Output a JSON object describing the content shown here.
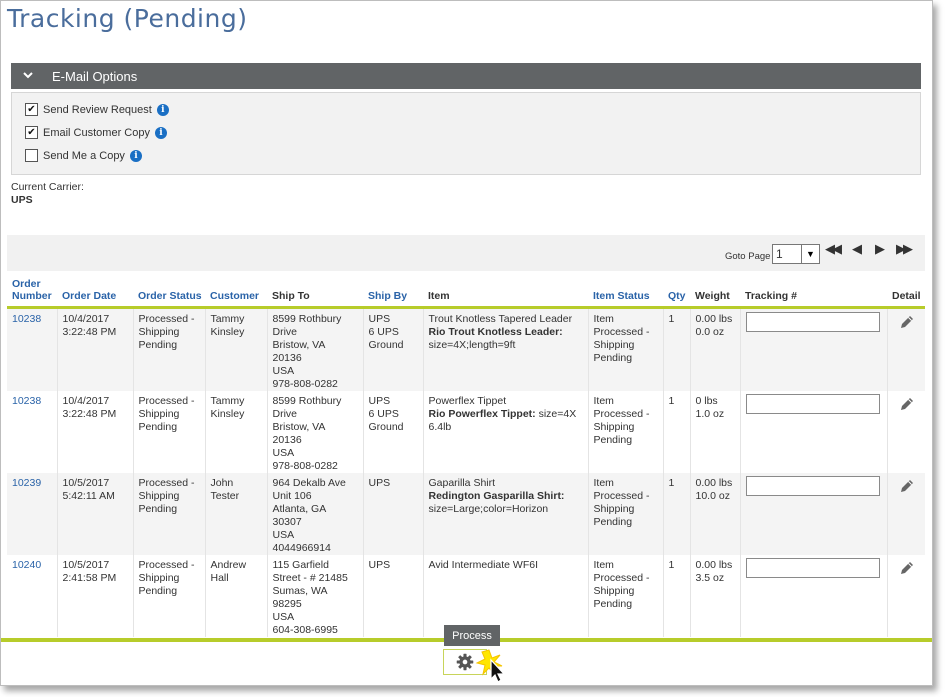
{
  "page": {
    "title": "Tracking (Pending)"
  },
  "email_options": {
    "title": "E-Mail Options",
    "options": [
      {
        "label": "Send Review Request",
        "checked": true
      },
      {
        "label": "Email Customer Copy",
        "checked": true
      },
      {
        "label": "Send Me a Copy",
        "checked": false
      }
    ]
  },
  "carrier": {
    "label": "Current Carrier:",
    "value": "UPS"
  },
  "pager": {
    "goto_label": "Goto Page",
    "page": "1"
  },
  "table": {
    "headers": {
      "order_number_1": "Order",
      "order_number_2": "Number",
      "order_date": "Order Date",
      "order_status": "Order Status",
      "customer": "Customer",
      "ship_to": "Ship To",
      "ship_by": "Ship By",
      "item": "Item",
      "item_status": "Item Status",
      "qty": "Qty",
      "weight": "Weight",
      "tracking": "Tracking #",
      "detail": "Detail"
    },
    "rows": [
      {
        "order_number": "10238",
        "date": "10/4/2017",
        "time": "3:22:48 PM",
        "status_1": "Processed -",
        "status_2": "Shipping",
        "status_3": "Pending",
        "customer_1": "Tammy",
        "customer_2": "Kinsley",
        "ship_1": "8599 Rothbury",
        "ship_2": "Drive",
        "ship_3": "Bristow, VA",
        "ship_4": "20136",
        "ship_5": "USA",
        "ship_6": "978-808-0282",
        "shipby_1": "UPS",
        "shipby_2": "6 UPS",
        "shipby_3": "Ground",
        "item_name": "Trout Knotless Tapered Leader",
        "item_detail_bold": "Rio Trout Knotless Leader:",
        "item_detail": "size=4X;length=9ft",
        "item_status_1": "Item",
        "item_status_2": "Processed -",
        "item_status_3": "Shipping",
        "item_status_4": "Pending",
        "qty": "1",
        "weight_1": "0.00 lbs",
        "weight_2": "0.0 oz"
      },
      {
        "order_number": "10238",
        "date": "10/4/2017",
        "time": "3:22:48 PM",
        "status_1": "Processed -",
        "status_2": "Shipping",
        "status_3": "Pending",
        "customer_1": "Tammy",
        "customer_2": "Kinsley",
        "ship_1": "8599 Rothbury",
        "ship_2": "Drive",
        "ship_3": "Bristow, VA",
        "ship_4": "20136",
        "ship_5": "USA",
        "ship_6": "978-808-0282",
        "shipby_1": "UPS",
        "shipby_2": "6 UPS",
        "shipby_3": "Ground",
        "item_name": "Powerflex Tippet",
        "item_detail_bold": "Rio Powerflex Tippet:",
        "item_detail": "size=4X 6.4lb",
        "item_status_1": "Item",
        "item_status_2": "Processed -",
        "item_status_3": "Shipping",
        "item_status_4": "Pending",
        "qty": "1",
        "weight_1": "0 lbs",
        "weight_2": "1.0 oz"
      },
      {
        "order_number": "10239",
        "date": "10/5/2017",
        "time": "5:42:11 AM",
        "status_1": "Processed -",
        "status_2": "Shipping",
        "status_3": "Pending",
        "customer_1": "John",
        "customer_2": "Tester",
        "ship_1": "964 Dekalb Ave",
        "ship_2": "Unit 106",
        "ship_3": "Atlanta, GA",
        "ship_4": "30307",
        "ship_5": "USA",
        "ship_6": "4044966914",
        "shipby_1": "UPS",
        "shipby_2": "",
        "shipby_3": "",
        "item_name": "Gaparilla Shirt",
        "item_detail_bold": "Redington Gasparilla Shirt:",
        "item_detail": "size=Large;color=Horizon",
        "item_status_1": "Item",
        "item_status_2": "Processed -",
        "item_status_3": "Shipping",
        "item_status_4": "Pending",
        "qty": "1",
        "weight_1": "0.00 lbs",
        "weight_2": "10.0 oz"
      },
      {
        "order_number": "10240",
        "date": "10/5/2017",
        "time": "2:41:58 PM",
        "status_1": "Processed -",
        "status_2": "Shipping",
        "status_3": "Pending",
        "customer_1": "Andrew",
        "customer_2": "Hall",
        "ship_1": "115 Garfield",
        "ship_2": "Street - # 21485",
        "ship_3": "Sumas, WA",
        "ship_4": "98295",
        "ship_5": "USA",
        "ship_6": "604-308-6995",
        "shipby_1": "UPS",
        "shipby_2": "",
        "shipby_3": "",
        "item_name": "Avid Intermediate WF6I",
        "item_detail_bold": "",
        "item_detail": "",
        "item_status_1": "Item",
        "item_status_2": "Processed -",
        "item_status_3": "Shipping",
        "item_status_4": "Pending",
        "qty": "1",
        "weight_1": "0.00 lbs",
        "weight_2": "3.5 oz"
      }
    ]
  },
  "footer": {
    "tooltip": "Process"
  },
  "colors": {
    "accent": "#b7cc2a",
    "link": "#2a63a8",
    "title": "#4a6d9c",
    "bar": "#616466",
    "info": "#1a6fc4"
  },
  "icons": [
    "chevron-down-icon",
    "info-icon",
    "first-page-icon",
    "prev-page-icon",
    "next-page-icon",
    "last-page-icon",
    "pencil-icon",
    "gear-icon",
    "cursor-icon"
  ]
}
